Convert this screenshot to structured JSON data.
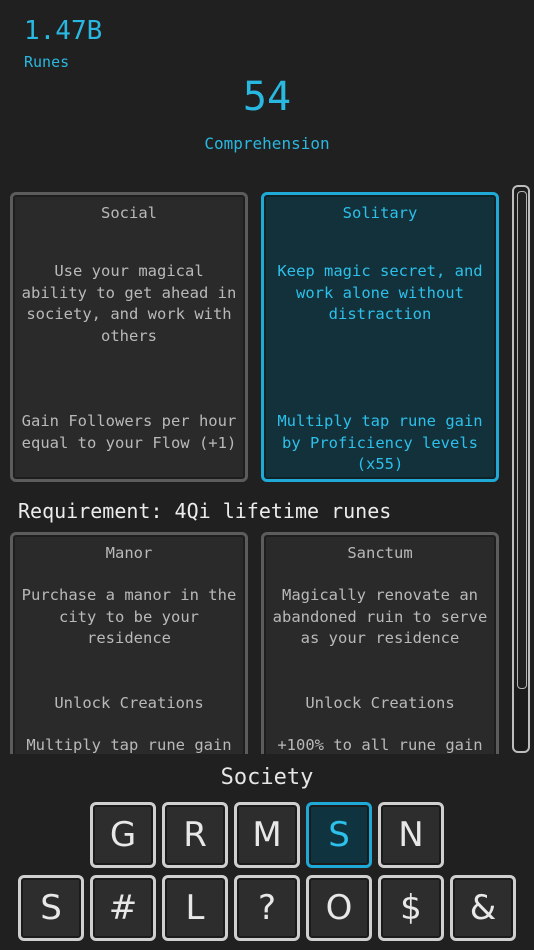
{
  "header": {
    "runes_value": "1.47B",
    "runes_label": "Runes",
    "comprehension_value": "54",
    "comprehension_label": "Comprehension"
  },
  "choices": [
    {
      "title": "Social",
      "description": "Use your magical ability to get ahead in society, and work with others",
      "effect": "Gain Followers per hour equal to your Flow (+1)",
      "selected": false
    },
    {
      "title": "Solitary",
      "description": "Keep magic secret, and work alone without distraction",
      "effect": "Multiply tap rune gain by Proficiency levels (x55)",
      "selected": true
    }
  ],
  "requirement": "Requirement: 4Qi lifetime runes",
  "locked_choices": [
    {
      "title": "Manor",
      "description": "Purchase a manor in the city to be your residence",
      "effect": "Unlock Creations",
      "effect2": "Multiply tap rune gain"
    },
    {
      "title": "Sanctum",
      "description": "Magically renovate an abandoned ruin to serve as your residence",
      "effect": "Unlock Creations",
      "effect2": "+100% to all rune gain"
    }
  ],
  "tab_label": "Society",
  "keyboard": {
    "row1": [
      "G",
      "R",
      "M",
      "S",
      "N"
    ],
    "row2": [
      "S",
      "#",
      "L",
      "?",
      "O",
      "$",
      "&"
    ],
    "active_key": "S (row 1)"
  },
  "colors": {
    "accent": "#29b8e0",
    "background": "#202020",
    "card_border": "#5c5c5c",
    "selected_bg": "#13313a"
  }
}
